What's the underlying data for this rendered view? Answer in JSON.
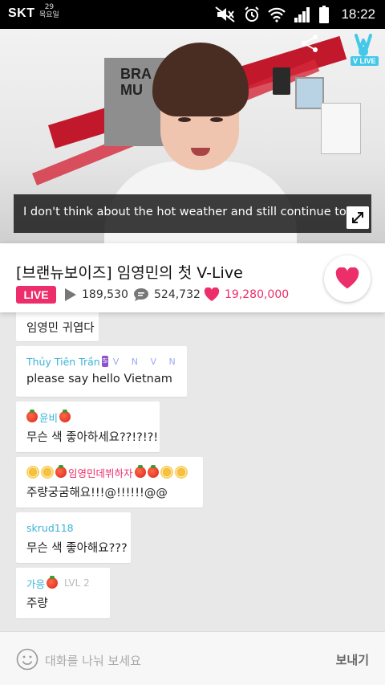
{
  "status_bar": {
    "carrier": "SKT",
    "date_day": "29",
    "date_weekday": "목요일",
    "time": "18:22",
    "icons": [
      "mute-icon",
      "alarm-icon",
      "wifi-icon",
      "signal-icon",
      "battery-icon"
    ]
  },
  "video": {
    "caption": "I don't think about the hot weather and still continue to lay",
    "wall_text_line1": "BRA",
    "wall_text_line2": "MU",
    "logo_text": "V LIVE",
    "share_icon": "share-icon",
    "expand_icon": "expand-icon"
  },
  "info": {
    "title": "[브랜뉴보이즈] 임영민의 첫 V-Live",
    "live_label": "LIVE",
    "views": "189,530",
    "comments": "524,732",
    "likes": "19,280,000",
    "accent_color": "#ec2f6a"
  },
  "chat": {
    "messages": [
      {
        "user": "",
        "text": "임영민 귀엽다"
      },
      {
        "user": "Thủy Tiên Trần",
        "user_suffix": "V N V N",
        "text": "please say hello Vietnam"
      },
      {
        "user": "윤비",
        "text": "무슨 색 좋아하세요??!?!?!"
      },
      {
        "user": "임영민데뷔하자",
        "text": "주량궁굼해요!!!@!!!!!!@@"
      },
      {
        "user": "skrud118",
        "text": "무슨 색 좋아해요???"
      },
      {
        "user": "가응",
        "level": "LVL 2",
        "text": "주량"
      }
    ]
  },
  "input": {
    "placeholder": "대화를 나눠 보세요",
    "send_label": "보내기"
  }
}
